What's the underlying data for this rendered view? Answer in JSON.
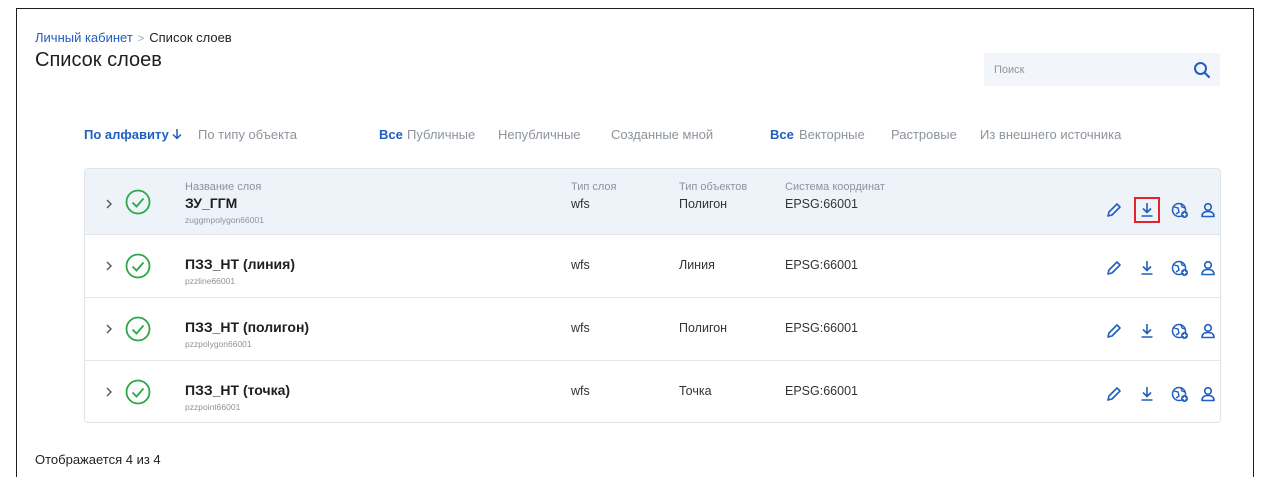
{
  "breadcrumb": {
    "parent": "Личный кабинет",
    "separator": ">",
    "current": "Список слоев"
  },
  "page_title": "Список слоев",
  "search": {
    "placeholder": "Поиск",
    "value": ""
  },
  "sort": {
    "by_alphabet": "По алфавиту",
    "by_object_type": "По типу объекта"
  },
  "visibility_filters": {
    "all": "Все",
    "public": "Публичные",
    "private": "Непубличные",
    "mine": "Созданные мной"
  },
  "kind_filters": {
    "all": "Все",
    "vector": "Векторные",
    "raster": "Растровые",
    "external": "Из внешнего источника"
  },
  "columns": {
    "name": "Название слоя",
    "layer_type": "Тип слоя",
    "object_type": "Тип объектов",
    "crs": "Система координат"
  },
  "layers": [
    {
      "name": "ЗУ_ГГМ",
      "code": "zuggmpolygon66001",
      "layer_type": "wfs",
      "object_type": "Полигон",
      "crs": "EPSG:66001"
    },
    {
      "name": "ПЗЗ_НТ (линия)",
      "code": "pzzline66001",
      "layer_type": "wfs",
      "object_type": "Линия",
      "crs": "EPSG:66001"
    },
    {
      "name": "ПЗЗ_НТ (полигон)",
      "code": "pzzpolygon66001",
      "layer_type": "wfs",
      "object_type": "Полигон",
      "crs": "EPSG:66001"
    },
    {
      "name": "ПЗЗ_НТ (точка)",
      "code": "pzzpoint66001",
      "layer_type": "wfs",
      "object_type": "Точка",
      "crs": "EPSG:66001"
    }
  ],
  "footer": {
    "shown": "Отображается 4 из 4"
  },
  "colors": {
    "accent": "#1f5fbf",
    "success": "#2aa84a",
    "highlight_row": "#eef3fa",
    "focus_outline": "#e0262b"
  },
  "icons": {
    "search": "search-icon",
    "sort": "arrow-down-icon",
    "expand": "chevron-right-icon",
    "status": "check-circle-icon",
    "edit": "pencil-icon",
    "download": "download-icon",
    "publish": "globe-add-icon",
    "access": "user-icon"
  }
}
